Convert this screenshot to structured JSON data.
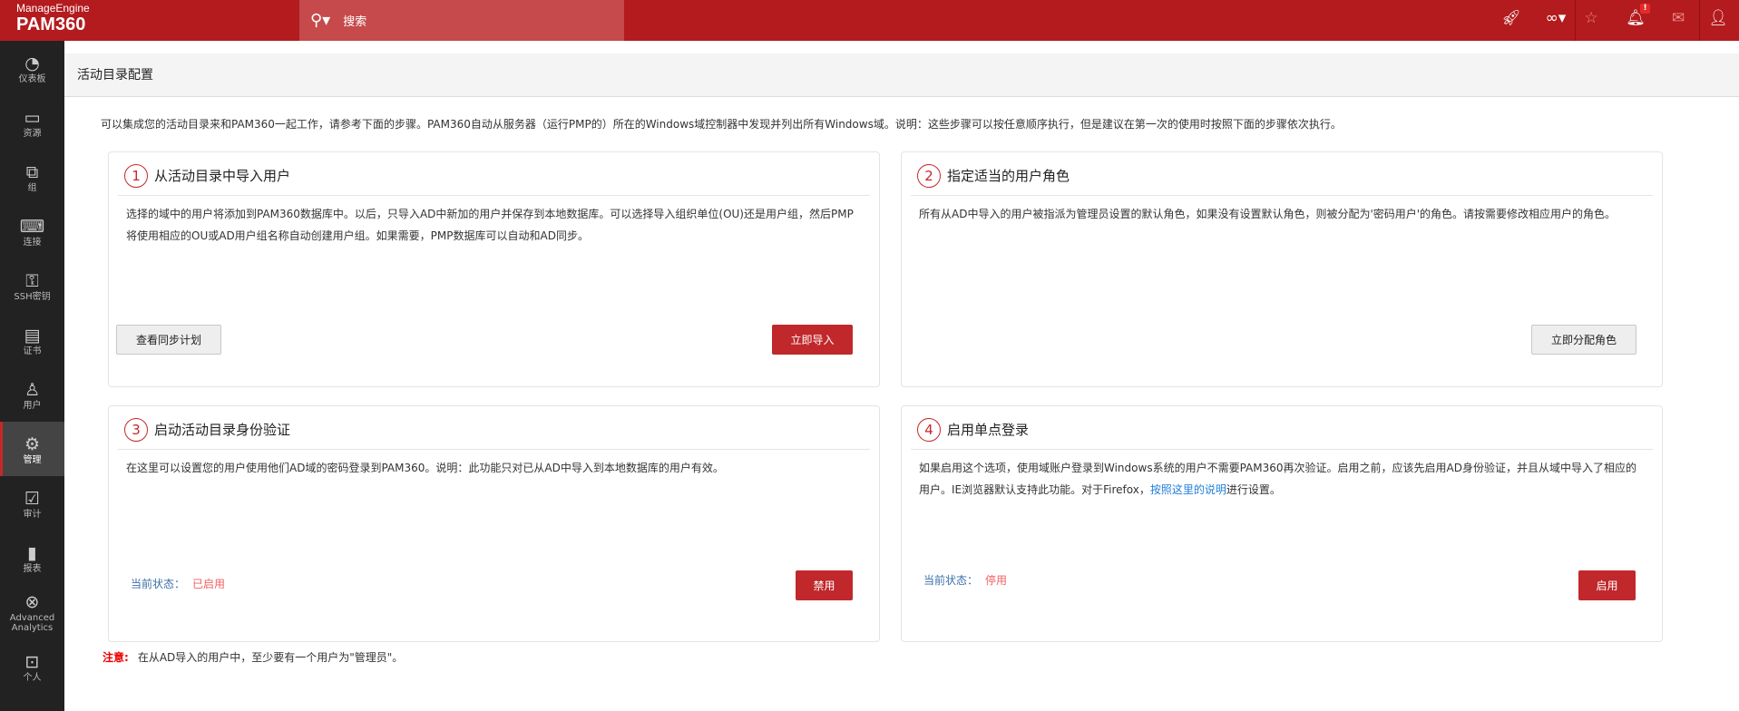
{
  "brand": {
    "vendor": "ManageEngine",
    "product": "PAM360"
  },
  "search": {
    "placeholder": "搜索"
  },
  "topbar": {
    "icons": [
      "rocket-icon",
      "link-icon",
      "user-star-icon",
      "bell-icon",
      "mail-icon",
      "user-icon"
    ],
    "bell_badge": "!"
  },
  "sidebar": {
    "items": [
      {
        "label": "仪表板",
        "icon": "dashboard-icon"
      },
      {
        "label": "资源",
        "icon": "monitor-icon"
      },
      {
        "label": "组",
        "icon": "groups-icon"
      },
      {
        "label": "连接",
        "icon": "connection-icon"
      },
      {
        "label": "SSH密钥",
        "icon": "ssh-key-icon"
      },
      {
        "label": "证书",
        "icon": "certificate-icon"
      },
      {
        "label": "用户",
        "icon": "user-icon"
      },
      {
        "label": "管理",
        "icon": "gear-icon",
        "active": true
      },
      {
        "label": "审计",
        "icon": "audit-icon"
      },
      {
        "label": "报表",
        "icon": "reports-icon"
      },
      {
        "label": "Advanced Analytics",
        "icon": "analytics-icon"
      },
      {
        "label": "个人",
        "icon": "personal-icon"
      }
    ]
  },
  "page": {
    "title": "活动目录配置",
    "intro": "可以集成您的活动目录来和PAM360一起工作，请参考下面的步骤。PAM360自动从服务器（运行PMP的）所在的Windows域控制器中发现并列出所有Windows域。说明：这些步骤可以按任意顺序执行，但是建议在第一次的使用时按照下面的步骤依次执行。"
  },
  "cards": [
    {
      "num": "1",
      "title": "从活动目录中导入用户",
      "text": "选择的域中的用户将添加到PAM360数据库中。以后，只导入AD中新加的用户并保存到本地数据库。可以选择导入组织单位(OU)还是用户组，然后PMP将使用相应的OU或AD用户组名称自动创建用户组。如果需要，PMP数据库可以自动和AD同步。",
      "secondary_button": "查看同步计划",
      "primary_button": "立即导入"
    },
    {
      "num": "2",
      "title": "指定适当的用户角色",
      "text": "所有从AD中导入的用户被指派为管理员设置的默认角色，如果没有设置默认角色，则被分配为'密码用户'的角色。请按需要修改相应用户的角色。",
      "secondary_button": "立即分配角色"
    },
    {
      "num": "3",
      "title": "启动活动目录身份验证",
      "text": "在这里可以设置您的用户使用他们AD域的密码登录到PAM360。说明：此功能只对已从AD中导入到本地数据库的用户有效。",
      "status_label": "当前状态：",
      "status_value": "已启用",
      "primary_button": "禁用"
    },
    {
      "num": "4",
      "title": "启用单点登录",
      "text_before": "如果启用这个选项，使用域账户登录到Windows系统的用户不需要PAM360再次验证。启用之前，应该先启用AD身份验证，并且从域中导入了相应的用户。IE浏览器默认支持此功能。对于Firefox，",
      "link": "按照这里的说明",
      "text_after": "进行设置。",
      "status_label": "当前状态：",
      "status_value": "停用",
      "primary_button": "启用"
    }
  ],
  "note": {
    "label": "注意:",
    "text": "在从AD导入的用户中，至少要有一个用户为\"管理员\"。"
  },
  "colors": {
    "brand": "#b31b1e",
    "button": "#c0282b",
    "sidebar": "#222222"
  }
}
